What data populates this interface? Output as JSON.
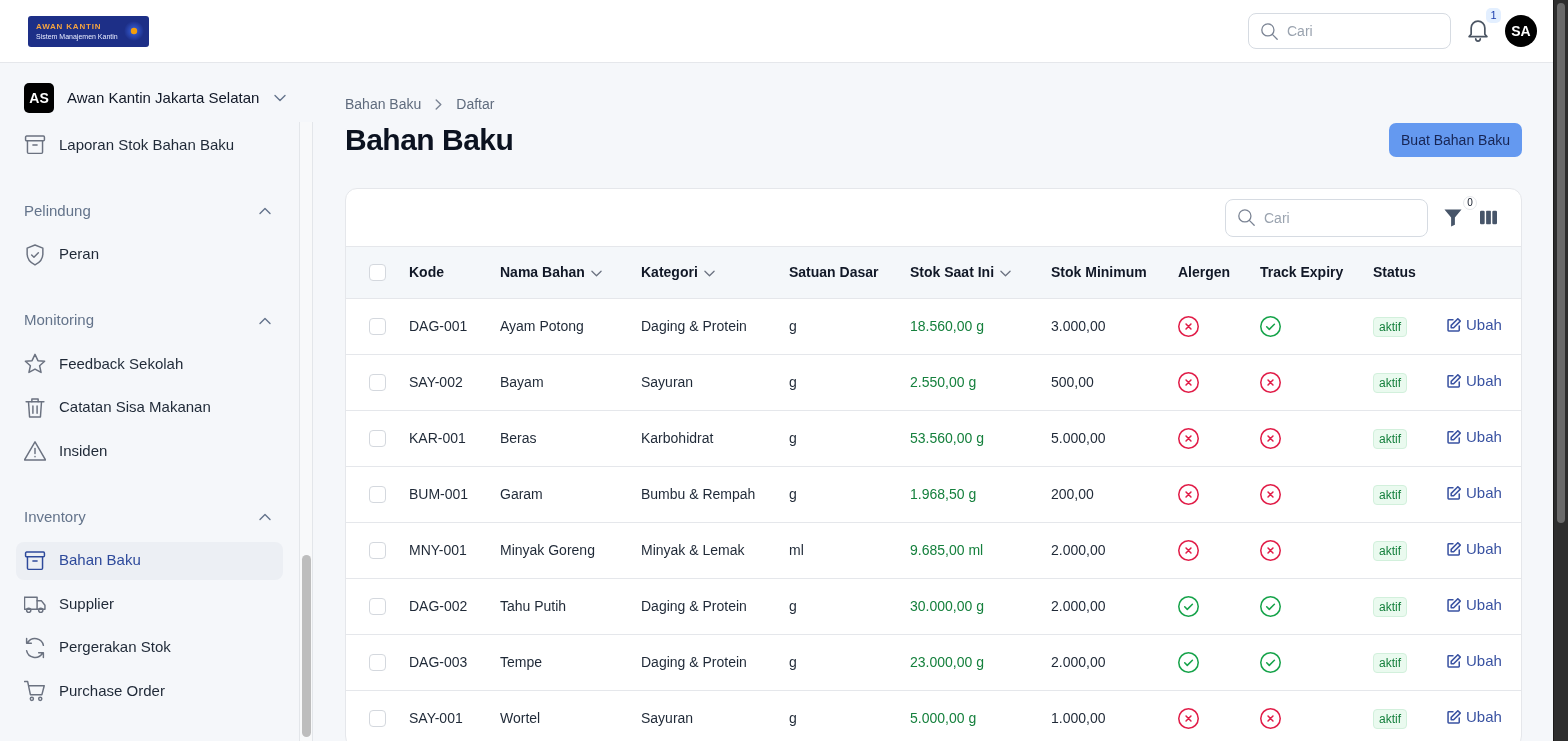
{
  "header": {
    "logo": {
      "title": "AWAN KANTIN",
      "subtitle": "Sistem Manajemen Kantin"
    },
    "search": {
      "placeholder": "Cari"
    },
    "notifications": {
      "count": "1"
    },
    "user": {
      "initials": "SA"
    }
  },
  "sidebar": {
    "team": {
      "initials": "AS",
      "name": "Awan Kantin Jakarta Selatan"
    },
    "groups": [
      {
        "items": [
          {
            "label": "Laporan Stok Bahan Baku",
            "selected": false
          }
        ]
      },
      {
        "label": "Pelindung",
        "expanded": true,
        "items": [
          {
            "label": "Peran",
            "selected": false
          }
        ]
      },
      {
        "label": "Monitoring",
        "expanded": true,
        "items": [
          {
            "label": "Feedback Sekolah",
            "selected": false
          },
          {
            "label": "Catatan Sisa Makanan",
            "selected": false
          },
          {
            "label": "Insiden",
            "selected": false
          }
        ]
      },
      {
        "label": "Inventory",
        "expanded": true,
        "items": [
          {
            "label": "Bahan Baku",
            "selected": true
          },
          {
            "label": "Supplier",
            "selected": false
          },
          {
            "label": "Pergerakan Stok",
            "selected": false
          },
          {
            "label": "Purchase Order",
            "selected": false
          }
        ]
      }
    ]
  },
  "breadcrumb": [
    {
      "label": "Bahan Baku"
    },
    {
      "label": "Daftar"
    }
  ],
  "page": {
    "title": "Bahan Baku",
    "create_button": "Buat Bahan Baku"
  },
  "table": {
    "search": {
      "placeholder": "Cari"
    },
    "filter_count": "0",
    "select_all": {
      "checked": false
    },
    "columns": [
      {
        "label": "Kode",
        "sortable": false
      },
      {
        "label": "Nama Bahan",
        "sortable": true
      },
      {
        "label": "Kategori",
        "sortable": true
      },
      {
        "label": "Satuan Dasar",
        "sortable": false
      },
      {
        "label": "Stok Saat Ini",
        "sortable": true
      },
      {
        "label": "Stok Minimum",
        "sortable": false
      },
      {
        "label": "Alergen",
        "sortable": false
      },
      {
        "label": "Track Expiry",
        "sortable": false
      },
      {
        "label": "Status",
        "sortable": false
      }
    ],
    "rows": [
      {
        "selected": false,
        "code": "DAG-001",
        "name": "Ayam Potong",
        "category": "Daging & Protein",
        "unit": "g",
        "stock": "18.560,00 g",
        "minimum": "3.000,00",
        "allergen": false,
        "track_expiry": true,
        "status": "aktif",
        "action": "Ubah"
      },
      {
        "selected": false,
        "code": "SAY-002",
        "name": "Bayam",
        "category": "Sayuran",
        "unit": "g",
        "stock": "2.550,00 g",
        "minimum": "500,00",
        "allergen": false,
        "track_expiry": false,
        "status": "aktif",
        "action": "Ubah"
      },
      {
        "selected": false,
        "code": "KAR-001",
        "name": "Beras",
        "category": "Karbohidrat",
        "unit": "g",
        "stock": "53.560,00 g",
        "minimum": "5.000,00",
        "allergen": false,
        "track_expiry": false,
        "status": "aktif",
        "action": "Ubah"
      },
      {
        "selected": false,
        "code": "BUM-001",
        "name": "Garam",
        "category": "Bumbu & Rempah",
        "unit": "g",
        "stock": "1.968,50 g",
        "minimum": "200,00",
        "allergen": false,
        "track_expiry": false,
        "status": "aktif",
        "action": "Ubah"
      },
      {
        "selected": false,
        "code": "MNY-001",
        "name": "Minyak Goreng",
        "category": "Minyak & Lemak",
        "unit": "ml",
        "stock": "9.685,00 ml",
        "minimum": "2.000,00",
        "allergen": false,
        "track_expiry": false,
        "status": "aktif",
        "action": "Ubah"
      },
      {
        "selected": false,
        "code": "DAG-002",
        "name": "Tahu Putih",
        "category": "Daging & Protein",
        "unit": "g",
        "stock": "30.000,00 g",
        "minimum": "2.000,00",
        "allergen": true,
        "track_expiry": true,
        "status": "aktif",
        "action": "Ubah"
      },
      {
        "selected": false,
        "code": "DAG-003",
        "name": "Tempe",
        "category": "Daging & Protein",
        "unit": "g",
        "stock": "23.000,00 g",
        "minimum": "2.000,00",
        "allergen": true,
        "track_expiry": true,
        "status": "aktif",
        "action": "Ubah"
      },
      {
        "selected": false,
        "code": "SAY-001",
        "name": "Wortel",
        "category": "Sayuran",
        "unit": "g",
        "stock": "5.000,00 g",
        "minimum": "1.000,00",
        "allergen": false,
        "track_expiry": false,
        "status": "aktif",
        "action": "Ubah"
      }
    ]
  }
}
